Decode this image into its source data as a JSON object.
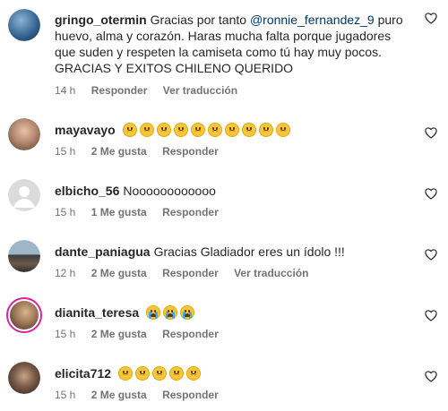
{
  "comments": [
    {
      "username": "gringo_otermin",
      "text_before": "Gracias por tanto ",
      "mention": "@ronnie_fernandez_9",
      "text_after": " puro huevo, alma y corazón. Haras mucha falta porque jugadores que suden y respeten la camiseta como tú hay muy pocos. GRACIAS Y EXITOS CHILENO QUERIDO",
      "time": "14 h",
      "reply": "Responder",
      "translate": "Ver traducción"
    },
    {
      "username": "mayavayo",
      "emoji": "worried-face",
      "emoji_count": 10,
      "time": "15 h",
      "likes": "2 Me gusta",
      "reply": "Responder"
    },
    {
      "username": "elbicho_56",
      "text": "Noooooooooooo",
      "time": "15 h",
      "likes": "1 Me gusta",
      "reply": "Responder"
    },
    {
      "username": "dante_paniagua",
      "text": "Gracias Gladiador eres un ídolo !!!",
      "time": "12 h",
      "likes": "2 Me gusta",
      "reply": "Responder",
      "translate": "Ver traducción"
    },
    {
      "username": "dianita_teresa",
      "emoji": "loudly-crying-face",
      "emoji_count": 3,
      "time": "15 h",
      "likes": "2 Me gusta",
      "reply": "Responder"
    },
    {
      "username": "elicita712",
      "emoji": "worried-face",
      "emoji_count": 5,
      "time": "15 h",
      "likes": "2 Me gusta",
      "reply": "Responder"
    }
  ],
  "icons": {
    "like": "heart-outline-icon"
  },
  "colors": {
    "mention": "#00376b",
    "meta": "#737373",
    "story_ring": "#d6249f"
  }
}
